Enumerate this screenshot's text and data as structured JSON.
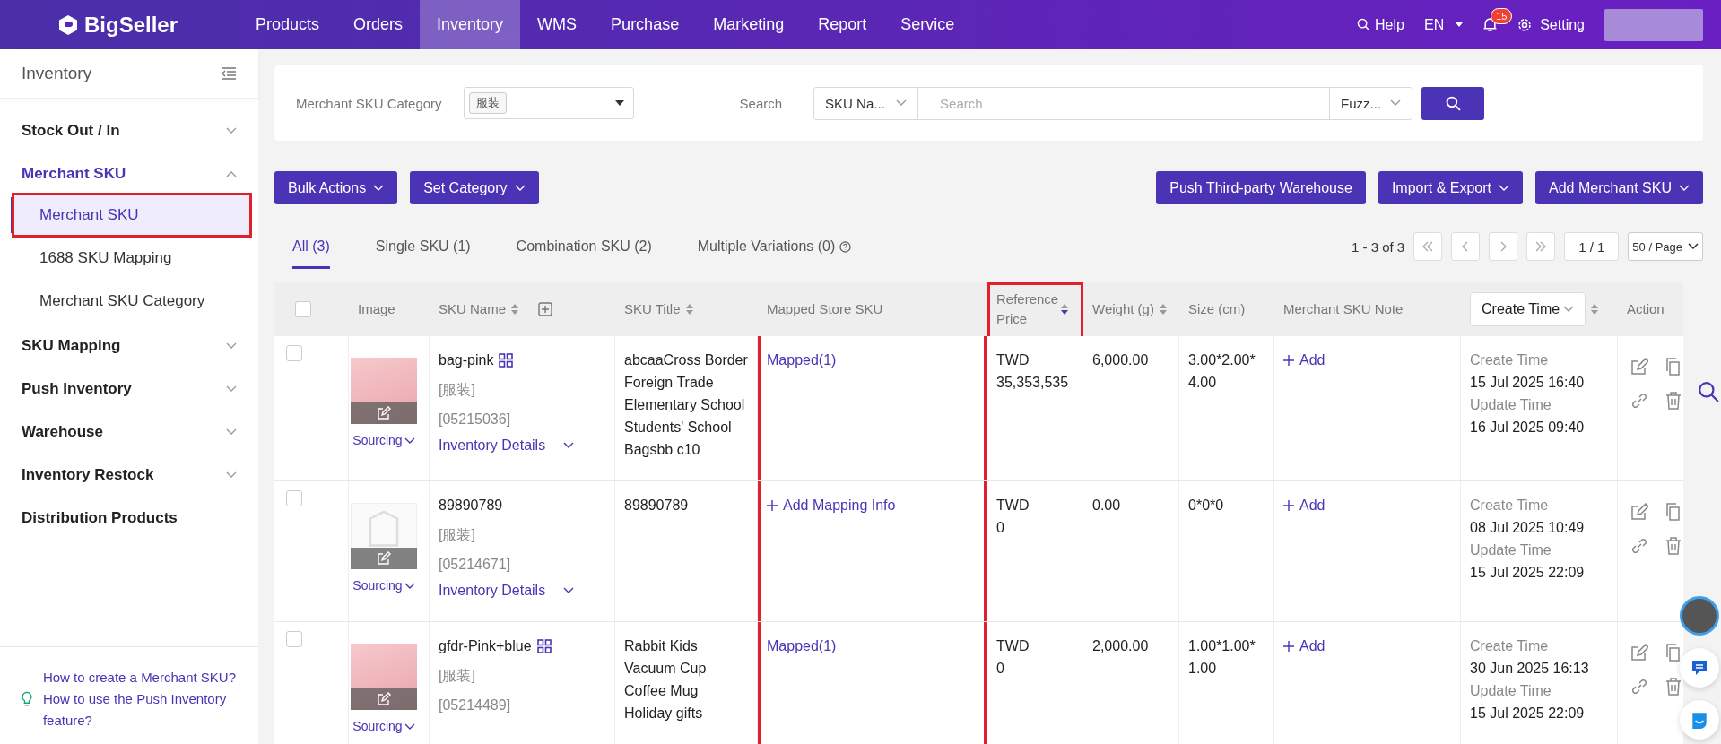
{
  "topbar": {
    "brand": "BigSeller",
    "nav": [
      {
        "label": "Products",
        "selected": false
      },
      {
        "label": "Orders",
        "selected": false
      },
      {
        "label": "Inventory",
        "selected": true
      },
      {
        "label": "WMS",
        "selected": false
      },
      {
        "label": "Purchase",
        "selected": false
      },
      {
        "label": "Marketing",
        "selected": false
      },
      {
        "label": "Report",
        "selected": false
      },
      {
        "label": "Service",
        "selected": false
      }
    ],
    "help": "Help",
    "language": "EN",
    "notification_count": "15",
    "setting": "Setting"
  },
  "sidebar": {
    "title": "Inventory",
    "groups": [
      {
        "label": "Stock Out / In",
        "expanded": false,
        "expandable": true
      },
      {
        "label": "Merchant SKU",
        "expanded": true,
        "expandable": true,
        "children": [
          {
            "label": "Merchant SKU",
            "selected": true,
            "highlighted": true
          },
          {
            "label": "1688 SKU Mapping",
            "selected": false,
            "highlighted": false
          },
          {
            "label": "Merchant SKU Category",
            "selected": false,
            "highlighted": false
          }
        ]
      },
      {
        "label": "SKU Mapping",
        "expanded": false,
        "expandable": true
      },
      {
        "label": "Push Inventory",
        "expanded": false,
        "expandable": true
      },
      {
        "label": "Warehouse",
        "expanded": false,
        "expandable": true
      },
      {
        "label": "Inventory Restock",
        "expanded": false,
        "expandable": true
      },
      {
        "label": "Distribution Products",
        "expanded": false,
        "expandable": false
      }
    ],
    "help_links": [
      "How to create a Merchant SKU?",
      "How to use the Push Inventory feature?"
    ]
  },
  "filters": {
    "category_label": "Merchant SKU Category",
    "category_tag": "服装",
    "search_label": "Search",
    "search_field": "SKU Na...",
    "search_placeholder": "Search",
    "match_mode": "Fuzz..."
  },
  "toolbar": {
    "left": [
      "Bulk Actions",
      "Set Category"
    ],
    "right": [
      "Push Third-party Warehouse",
      "Import & Export",
      "Add Merchant SKU"
    ]
  },
  "tabs": [
    {
      "label": "All (3)",
      "selected": true,
      "info": false
    },
    {
      "label": "Single SKU (1)",
      "selected": false,
      "info": false
    },
    {
      "label": "Combination SKU (2)",
      "selected": false,
      "info": false
    },
    {
      "label": "Multiple Variations (0)",
      "selected": false,
      "info": true
    }
  ],
  "pagination": {
    "summary": "1 - 3 of 3",
    "page": "1 / 1",
    "page_size": "50 / Page"
  },
  "table": {
    "all_checked": false,
    "columns": [
      {
        "label": "Image",
        "kind": "plain",
        "highlighted": false
      },
      {
        "label": "SKU Name",
        "kind": "sort",
        "sorted": false,
        "highlighted": false
      },
      {
        "label": "SKU Title",
        "kind": "sort",
        "sorted": false,
        "highlighted": false
      },
      {
        "label": "Mapped Store SKU",
        "kind": "plain",
        "highlighted": false
      },
      {
        "label": "Reference Price",
        "kind": "sort",
        "sorted": true,
        "highlighted": true
      },
      {
        "label": "Weight (g)",
        "kind": "sort",
        "sorted": false,
        "highlighted": false
      },
      {
        "label": "Size (cm)",
        "kind": "plain",
        "highlighted": false
      },
      {
        "label": "Merchant SKU Note",
        "kind": "plain",
        "highlighted": false
      },
      {
        "label": "Create Time",
        "kind": "select",
        "sorted": false,
        "highlighted": false
      },
      {
        "label": "Action",
        "kind": "plain",
        "highlighted": false
      }
    ],
    "rows": [
      {
        "checked": false,
        "has_image": true,
        "sourcing": "Sourcing",
        "name": "bag-pink",
        "variants_icon": true,
        "category": "[服装]",
        "code": "[05215036]",
        "inventory_details": "Inventory Details",
        "title": "abcaaCross Border Foreign Trade Elementary School Students' School Bagsbb c10",
        "mapping": {
          "kind": "link",
          "text": "Mapped(1)"
        },
        "price": [
          "TWD",
          "35,353,535"
        ],
        "weight": "6,000.00",
        "size": "3.00*2.00*4.00",
        "note": "Add",
        "times": [
          {
            "label": "Create Time",
            "value": "15 Jul 2025 16:40"
          },
          {
            "label": "Update Time",
            "value": "16 Jul 2025 09:40"
          }
        ]
      },
      {
        "checked": false,
        "has_image": false,
        "sourcing": "Sourcing",
        "name": "89890789",
        "variants_icon": false,
        "category": "[服装]",
        "code": "[05214671]",
        "inventory_details": "Inventory Details",
        "title": "89890789",
        "mapping": {
          "kind": "add",
          "text": "Add Mapping Info"
        },
        "price": [
          "TWD",
          "0"
        ],
        "weight": "0.00",
        "size": "0*0*0",
        "note": "Add",
        "times": [
          {
            "label": "Create Time",
            "value": "08 Jul 2025 10:49"
          },
          {
            "label": "Update Time",
            "value": "15 Jul 2025 22:09"
          }
        ]
      },
      {
        "checked": false,
        "has_image": true,
        "sourcing": "Sourcing",
        "name": "gfdr-Pink+blue",
        "variants_icon": true,
        "category": "[服装]",
        "code": "[05214489]",
        "title": "Rabbit Kids Vacuum Cup Coffee Mug Holiday gifts",
        "mapping": {
          "kind": "link",
          "text": "Mapped(1)"
        },
        "price": [
          "TWD",
          "0"
        ],
        "weight": "2,000.00",
        "size": "1.00*1.00*1.00",
        "note": "Add",
        "times": [
          {
            "label": "Create Time",
            "value": "30 Jun 2025 16:13"
          },
          {
            "label": "Update Time",
            "value": "15 Jul 2025 22:09"
          }
        ]
      }
    ]
  }
}
